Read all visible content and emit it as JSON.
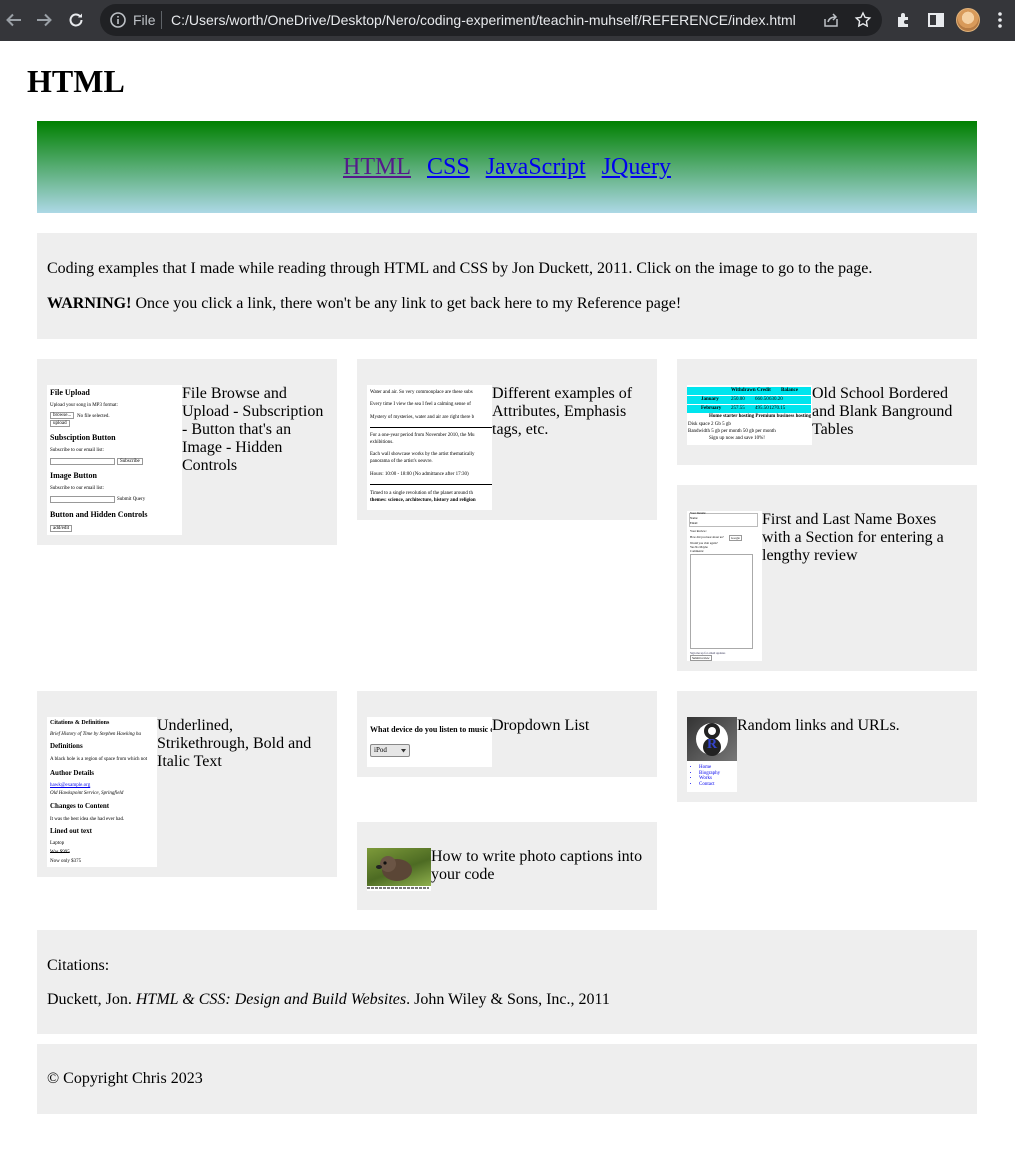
{
  "browser": {
    "scheme_label": "File",
    "url": "C:/Users/worth/OneDrive/Desktop/Nero/coding-experiment/teachin-muhself/REFERENCE/index.html"
  },
  "page": {
    "title": "HTML"
  },
  "nav": {
    "links": [
      "HTML",
      "CSS",
      "JavaScript",
      "JQuery"
    ]
  },
  "intro": {
    "text": "Coding examples that I made while reading through HTML and CSS by Jon Duckett, 2011. Click on the image to go to the page.",
    "warning_label": "WARNING!",
    "warning_text": " Once you click a link, there won't be any link to get back here to my Reference page!"
  },
  "cards": [
    {
      "caption": "File Browse and Upload - Subscription - Button that's an Image - Hidden Controls",
      "thumb": {
        "h1": "File Upload",
        "t1": "Upload your song in MP3 format:",
        "b1": "browse...",
        "t1b": "No file selected.",
        "b2": "upload",
        "h2": "Subsciption Button",
        "t2": "Subscribe to our email list:",
        "b3": "Subscribe",
        "h3": "Image Button",
        "t3": "Subscribe to our email list:",
        "t3b": "Submit Query",
        "h4": "Button and Hidden Controls",
        "b4": "add/edit"
      }
    },
    {
      "caption": "Different examples of Attributes, Emphasis tags, etc.",
      "thumb": {
        "l1": "Water and air. So very commonplace are these subs",
        "l2": "Every time I view the sea I feel a calming sense of",
        "l3": "Mystery of mysteries, water and air are right there b",
        "l4": "For a one-year period from November 2010, the Mu",
        "l5": "exhibitions.",
        "l6": "Each wall showcase works by the artist thematically",
        "l7": "panorama of the artist's oeuvre.",
        "l8": "Hours: 10:00 - 18:00 (No admittance after 17:30)",
        "l9": "Timed to a single revolution of the planet around th",
        "l10": "themes: science, architecture, history and religion"
      }
    },
    {
      "caption": "Old School Bordered and Blank Banground Tables",
      "thumb": {
        "c1": "Withdrawn",
        "c2": "Credit",
        "c3": "Balance",
        "r1": "January",
        "r1a": "250.00",
        "r1b": "660.50",
        "r1c": "630.20",
        "r2": "February",
        "r2a": "257.55",
        "r2b": "495.50",
        "r2c": "1270.15",
        "t1": "Home starter hosting   Premium business hosting",
        "t2": "Disk space   2 Gb        5 gb",
        "t3": "Bandwidth  5 gb per month   50 gb per month",
        "t4": "Sign up now and save 10%!"
      }
    },
    {
      "caption": "First and Last Name Boxes with a Section for entering a lengthy review",
      "thumb": {
        "s1": "Your Details:",
        "s2": "Name:",
        "s3": "Email:",
        "s4": "Your Review:",
        "s5": "How did you hear about us?",
        "s6": "Google",
        "s7": "Would you visit again?",
        "s8": "Yes  No  Maybe",
        "s9": "Comments:",
        "s10": "Sign me up for email updates",
        "s11": "Submit review"
      }
    },
    {
      "caption": "Underlined, Strikethrough, Bold and Italic Text",
      "thumb": {
        "h1": "Citations & Definitions",
        "t1": "Brief History of Time by Stephen Hawking ha",
        "h2": "Definitions",
        "t2": "A black hole is a region of space from which not",
        "h3": "Author Details",
        "t3": "hawk@example.org",
        "t3b": "Old Hawkspoint Service, Springfield",
        "h4": "Changes to Content",
        "t4": "It was the        best idea she had ever had.",
        "h5": "Lined out text",
        "t5": "Laptop",
        "t6": "Was $995",
        "t7": "Now only $375"
      }
    },
    {
      "caption": "Dropdown List",
      "thumb": {
        "q": "What device do you listen to music on?",
        "sel": "iPod"
      }
    },
    {
      "caption": "Random links and URLs.",
      "thumb": {
        "logo_letter": "R",
        "l1": "Home",
        "l2": "Biography",
        "l3": "Works",
        "l4": "Contact"
      }
    },
    {
      "caption": "How to write photo captions into your code"
    }
  ],
  "citations": {
    "label": "Citations:",
    "prefix": "Duckett, Jon. ",
    "book_title": "HTML & CSS: Design and Build Websites",
    "suffix": ". John Wiley & Sons, Inc., 2011"
  },
  "footer": {
    "copyright": "© Copyright Chris 2023"
  },
  "colors": {
    "chrome_bg": "#35363a",
    "omnibox_bg": "#202124",
    "banner_top": "#008000",
    "banner_bottom": "#add8e6",
    "panel_bg": "#eeeeee",
    "link": "#0000ee",
    "visited_link": "#551a8b"
  }
}
